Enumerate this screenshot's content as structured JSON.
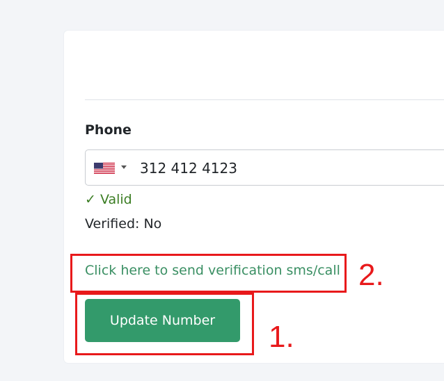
{
  "form": {
    "phone_label": "Phone",
    "phone_value": "312 412 4123",
    "country_flag": "us-flag-icon",
    "valid_text": "✓ Valid",
    "verified_text": "Verified: No",
    "verify_link": "Click here to send verification sms/call",
    "update_button": "Update Number"
  },
  "annotations": {
    "label_1": "1.",
    "label_2": "2.",
    "color": "#e8191b"
  },
  "colors": {
    "accent": "#339a6b",
    "link": "#3a8f63",
    "valid": "#3b7d23"
  }
}
